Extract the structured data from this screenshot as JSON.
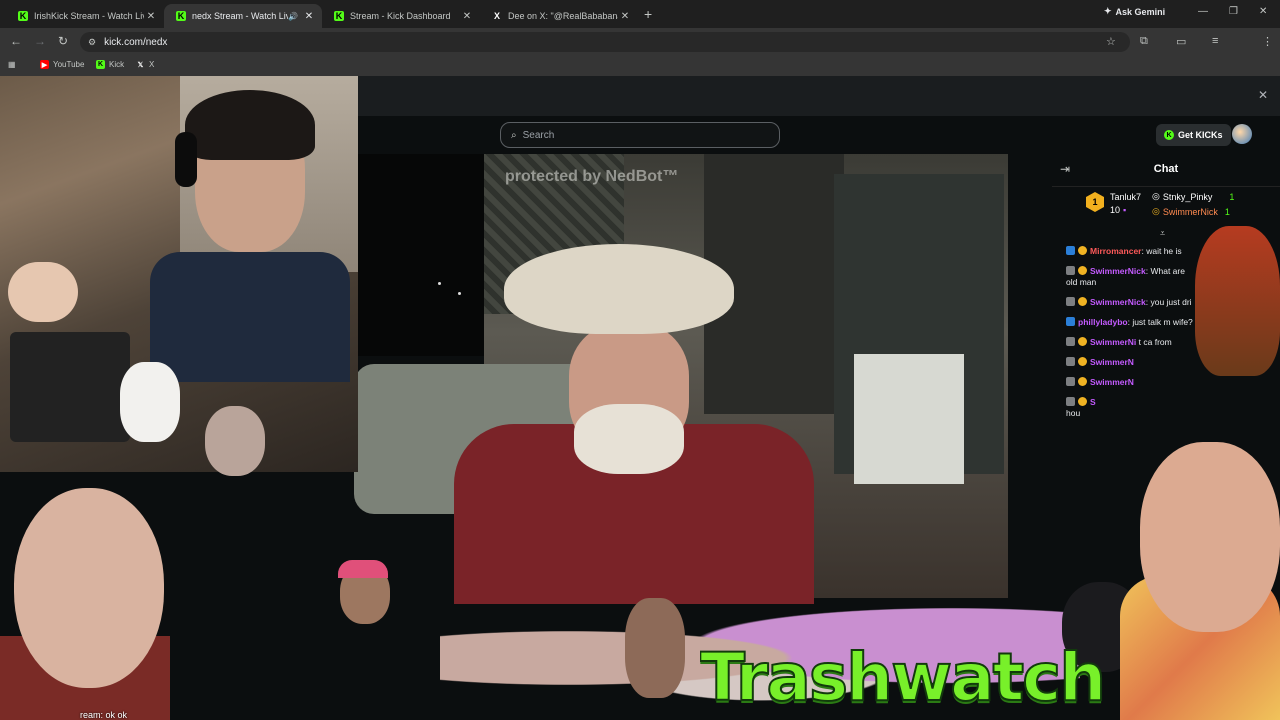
{
  "browser": {
    "tabs": [
      {
        "title": "IrishKick Stream - Watch Live o",
        "active": false,
        "favicon": "kick-favicon"
      },
      {
        "title": "nedx Stream - Watch Live o",
        "active": true,
        "favicon": "kick-favicon"
      },
      {
        "title": "Stream - Kick Dashboard",
        "active": false,
        "favicon": "kick-favicon"
      },
      {
        "title": "Dee on X: \"@RealBababanaras",
        "active": false,
        "favicon": "x-favicon"
      }
    ],
    "ask_gemini": "Ask Gemini",
    "url": "kick.com/nedx",
    "bookmarks": [
      {
        "label": "YouTube",
        "icon": "youtube-icon"
      },
      {
        "label": "Kick",
        "icon": "kick-icon"
      },
      {
        "label": "X",
        "icon": "x-icon"
      }
    ]
  },
  "kick": {
    "search_placeholder": "Search",
    "get_kicks": "Get KICKs"
  },
  "stream": {
    "watermark": "protected by NedBot™",
    "overlay_title": "Trashwatch",
    "chat_overlay_fragment": "ream: ok ok"
  },
  "chat": {
    "title": "Chat",
    "leaderboard": {
      "rank_badge": "1",
      "top_gifter": {
        "name": "Tanluk7",
        "count": "10"
      },
      "entries": [
        {
          "name": "Stnky_Pinky",
          "count": "1"
        },
        {
          "name": "SwimmerNick",
          "count": "1"
        }
      ]
    },
    "messages": [
      {
        "user": "Mirromancer",
        "text": ": wait he is",
        "user_color": "red"
      },
      {
        "user": "SwimmerNick",
        "text": ": What are",
        "continuation": "old man"
      },
      {
        "user": "SwimmerNick",
        "text": ": you just dri"
      },
      {
        "user": "phillyladybo",
        "text": ": just talk m   wife?"
      },
      {
        "user": "SwimmerNi",
        "text": "    t ca    from"
      },
      {
        "user": "SwimmerN",
        "text": ""
      },
      {
        "user": "SwimmerN",
        "text": ""
      },
      {
        "user": "S",
        "text": "",
        "continuation": "hou"
      }
    ]
  }
}
